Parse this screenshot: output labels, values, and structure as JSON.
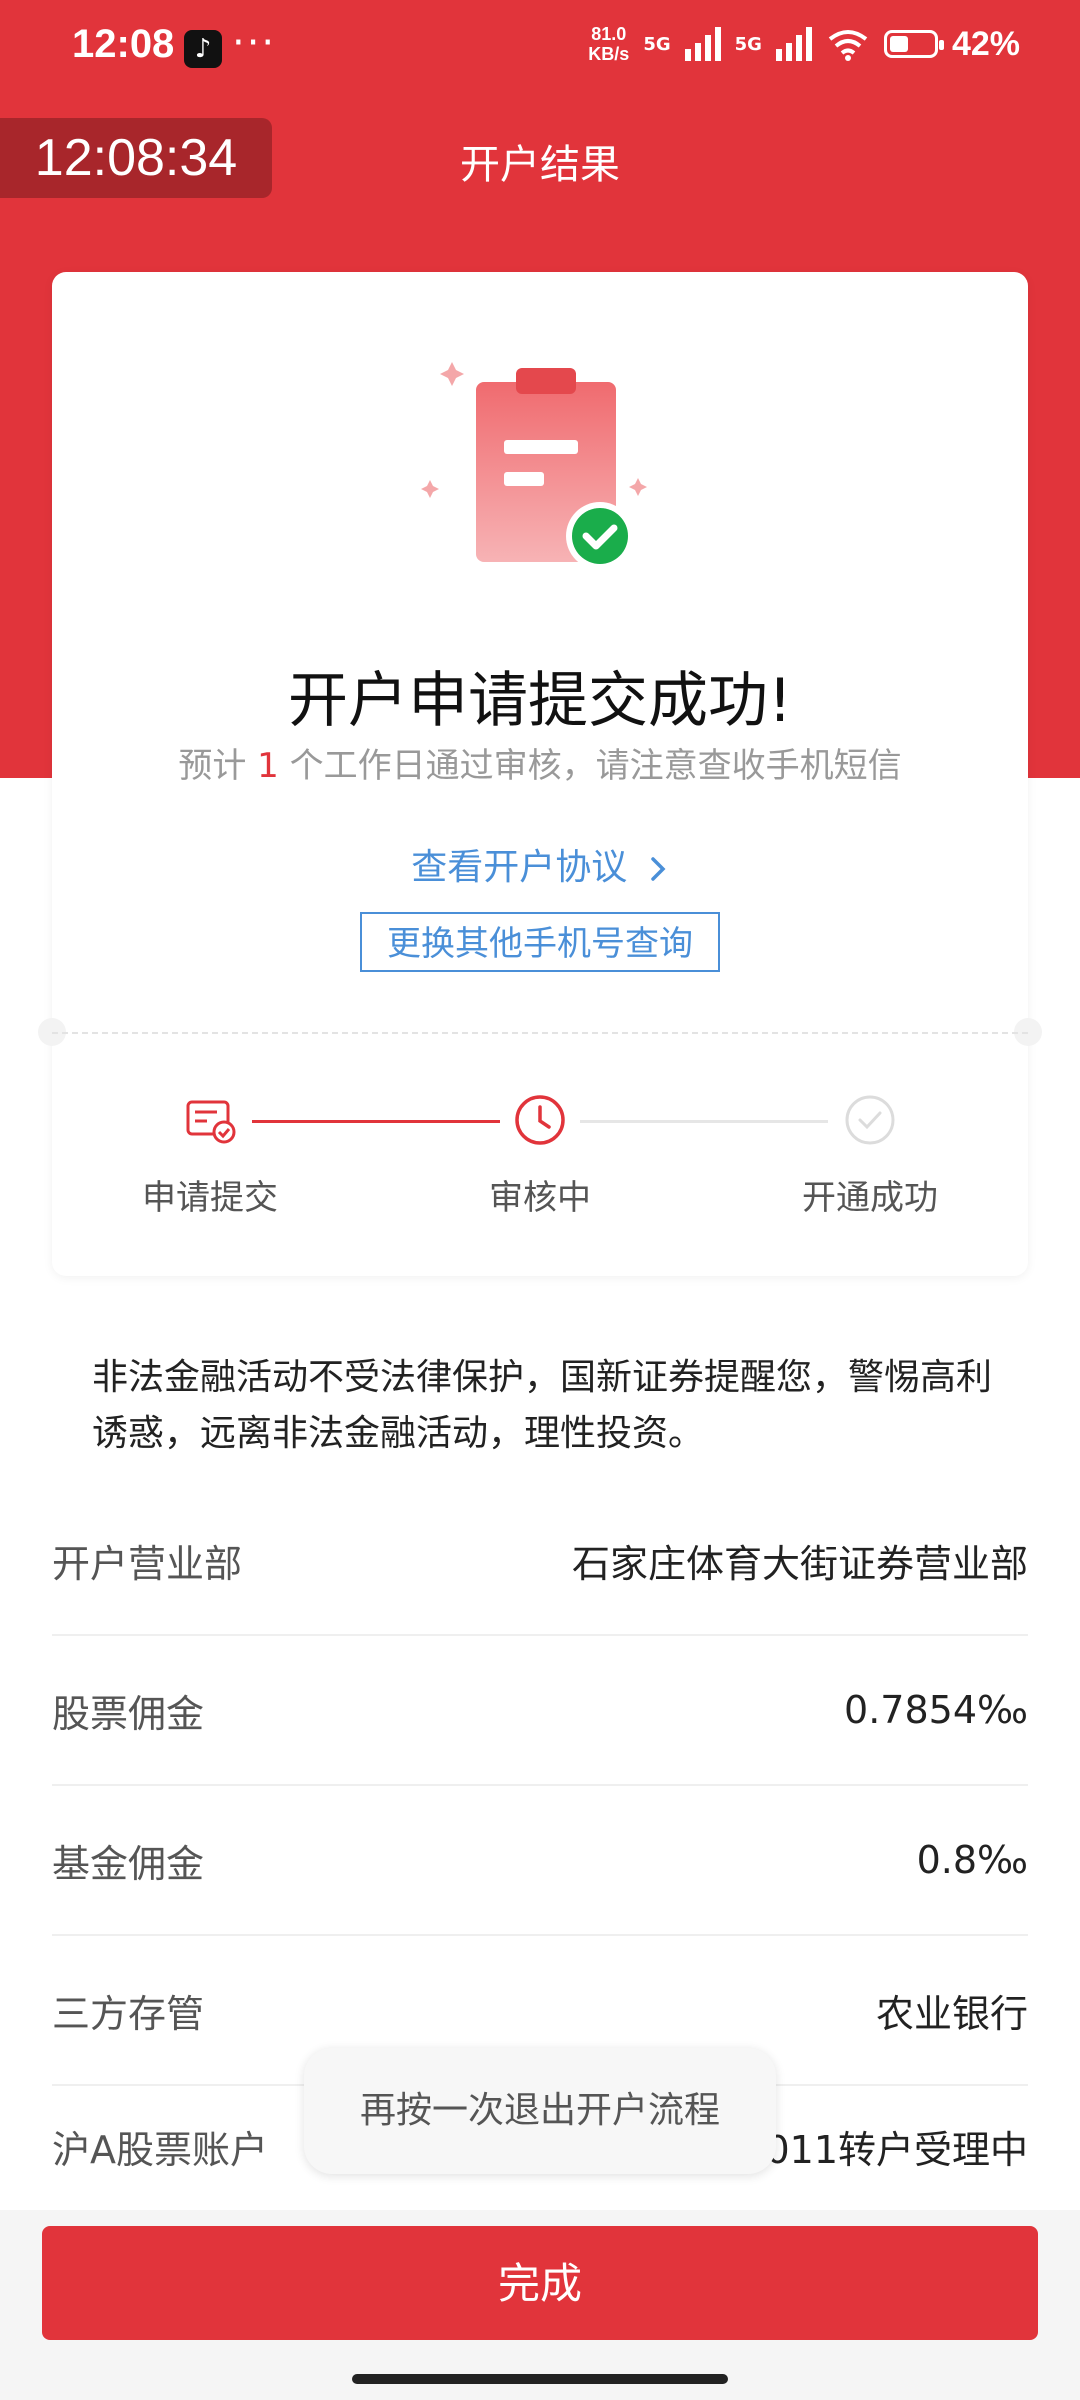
{
  "status_bar": {
    "time": "12:08",
    "speed_value": "81.0",
    "speed_unit": "KB/s",
    "net1": "5G",
    "net2": "5G",
    "battery_text": "42%",
    "battery_level": 0.42,
    "icons": [
      "tiktok-icon",
      "more-dots-icon",
      "signal-icon",
      "wifi-icon",
      "battery-icon"
    ]
  },
  "header": {
    "clock": "12:08:34",
    "title": "开户结果"
  },
  "card": {
    "title": "开户申请提交成功!",
    "sub_prefix": "预计",
    "sub_num": "1",
    "sub_suffix": "个工作日通过审核，请注意查收手机短信",
    "agreement_link": "查看开户协议",
    "change_phone": "更换其他手机号查询",
    "steps": [
      {
        "label": "申请提交",
        "icon": "submit-card-icon"
      },
      {
        "label": "审核中",
        "icon": "clock-icon"
      },
      {
        "label": "开通成功",
        "icon": "check-circle-icon"
      }
    ]
  },
  "notice": "非法金融活动不受法律保护，国新证券提醒您，警惕高利诱惑，远离非法金融活动，理性投资。",
  "info": [
    {
      "label": "开户营业部",
      "value": "石家庄体育大街证券营业部"
    },
    {
      "label": "股票佣金",
      "value": "0.7854‰"
    },
    {
      "label": "基金佣金",
      "value": "0.8‰"
    },
    {
      "label": "三方存管",
      "value": "农业银行"
    },
    {
      "label": "沪A股票账户",
      "value": "011转户受理中"
    }
  ],
  "toast": "再按一次退出开户流程",
  "done_button": "完成",
  "colors": {
    "brand_red": "#e1343b",
    "link_blue": "#4a8fd8",
    "success_green": "#1aad4b"
  }
}
